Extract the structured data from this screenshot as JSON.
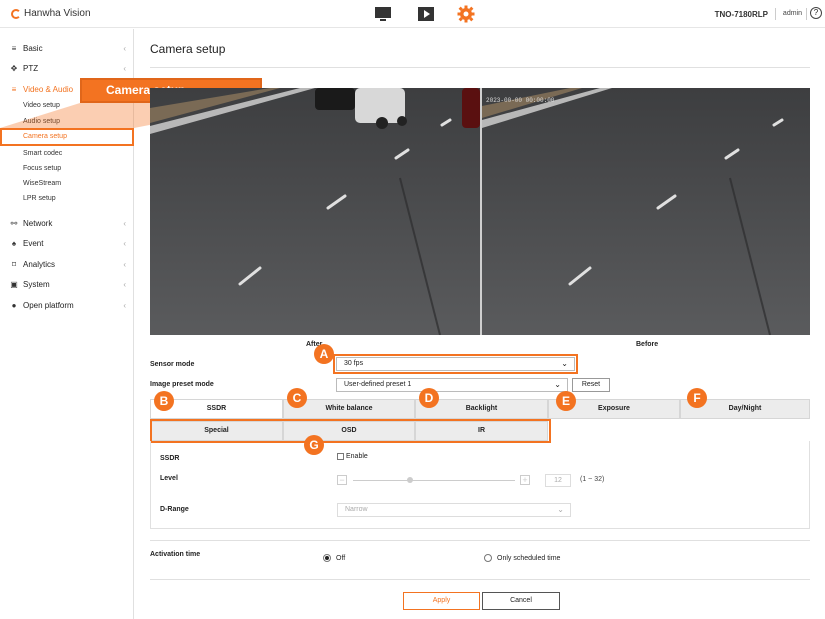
{
  "topbar": {
    "brand": "Hanwha Vision",
    "model": "TNO-7180RLP",
    "user": "admin",
    "help_glyph": "?",
    "icons": [
      "monitor-icon",
      "play-icon",
      "gear-icon"
    ],
    "accent": "#f37321"
  },
  "sidebar": {
    "items": [
      {
        "label": "Basic",
        "icon": "list-icon",
        "glyph": "≡"
      },
      {
        "label": "PTZ",
        "icon": "move-icon",
        "glyph": "✥"
      },
      {
        "label": "Video & Audio",
        "icon": "list-icon",
        "glyph": "≡"
      },
      {
        "label": "Network",
        "icon": "network-icon",
        "glyph": "⚯"
      },
      {
        "label": "Event",
        "icon": "bell-icon",
        "glyph": "♠"
      },
      {
        "label": "Analytics",
        "icon": "frame-icon",
        "glyph": "⌑"
      },
      {
        "label": "System",
        "icon": "system-icon",
        "glyph": "▣"
      },
      {
        "label": "Open platform",
        "icon": "platform-icon",
        "glyph": "●"
      }
    ],
    "chevron": "‹",
    "sub_items": [
      "Video setup",
      "Audio setup",
      "Camera setup",
      "Smart codec",
      "Focus setup",
      "WiseStream",
      "LPR setup"
    ]
  },
  "callout": {
    "label": "Camera setup"
  },
  "main": {
    "title": "Camera setup",
    "after_label": "After",
    "before_label": "Before",
    "sensor_mode": {
      "label": "Sensor mode",
      "value": "30 fps"
    },
    "image_preset": {
      "label": "Image preset mode",
      "value": "User-defined preset 1",
      "reset_label": "Reset"
    },
    "tabs_row1": [
      "SSDR",
      "White balance",
      "Backlight",
      "Exposure",
      "Day/Night"
    ],
    "tabs_row2": [
      "Special",
      "OSD",
      "IR"
    ],
    "ssdr": {
      "label": "SSDR",
      "enable_label": "Enable",
      "level_label": "Level",
      "level_minus": "−",
      "level_plus": "+",
      "level_value": "12",
      "level_range": "(1 ~ 32)",
      "level_fraction": 0.35,
      "drange_label": "D-Range",
      "drange_value": "Narrow"
    },
    "activation": {
      "label": "Activation time",
      "off_label": "Off",
      "scheduled_label": "Only scheduled time"
    },
    "apply_label": "Apply",
    "cancel_label": "Cancel",
    "overlay_text": "2023-00-00 00:00:00"
  },
  "badges": [
    "A",
    "B",
    "C",
    "D",
    "E",
    "F",
    "G"
  ]
}
